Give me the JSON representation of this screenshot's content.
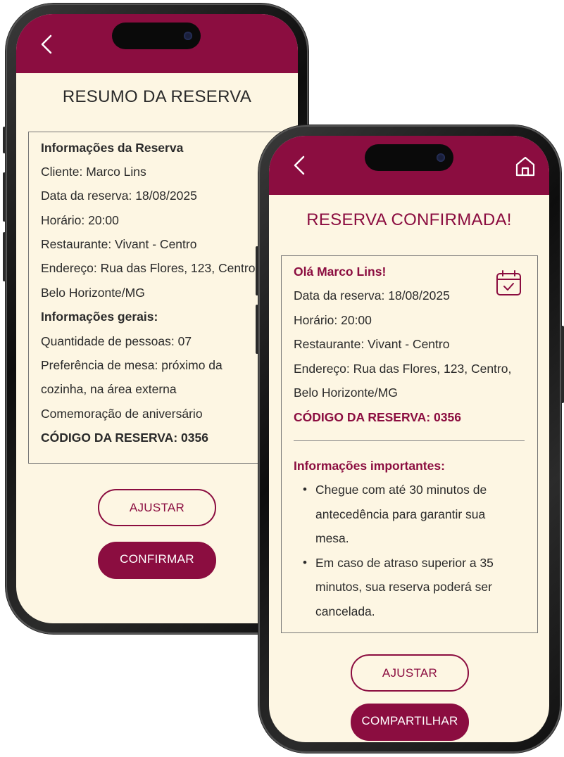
{
  "colors": {
    "accent": "#8b0d40",
    "background": "#fdf6e3",
    "text": "#2a2a2a"
  },
  "summary_screen": {
    "back_icon": "chevron-left-icon",
    "title": "RESUMO DA RESERVA",
    "section1_heading": "Informações da Reserva",
    "client": "Cliente: Marco Lins",
    "date": "Data da reserva: 18/08/2025",
    "time": "Horário: 20:00",
    "restaurant": "Restaurante: Vivant - Centro",
    "address_line1": "Endereço: Rua das Flores, 123, Centro,",
    "address_line2": "Belo Horizonte/MG",
    "section2_heading": "Informações gerais:",
    "people": "Quantidade de pessoas: 07",
    "table_pref_line1": "Preferência de mesa: próximo da",
    "table_pref_line2": "cozinha, na área externa",
    "celebration": "Comemoração de aniversário",
    "code": "CÓDIGO DA RESERVA: 0356",
    "adjust_button": "AJUSTAR",
    "confirm_button": "CONFIRMAR"
  },
  "confirmation_screen": {
    "back_icon": "chevron-left-icon",
    "home_icon": "home-icon",
    "title": "RESERVA CONFIRMADA!",
    "greeting": "Olá Marco Lins!",
    "calendar_icon": "calendar-check-icon",
    "date": "Data da reserva: 18/08/2025",
    "time": "Horário: 20:00",
    "restaurant": "Restaurante: Vivant - Centro",
    "address_line1": "Endereço: Rua das Flores, 123, Centro,",
    "address_line2": "Belo Horizonte/MG",
    "code": "CÓDIGO DA RESERVA: 0356",
    "important_heading": "Informações importantes:",
    "notes": [
      {
        "lines": [
          "Chegue com até 30 minutos de",
          "antecedência para garantir sua",
          "mesa."
        ]
      },
      {
        "lines": [
          "Em caso de atraso superior a 35",
          "minutos, sua reserva poderá ser",
          "cancelada."
        ]
      }
    ],
    "adjust_button": "AJUSTAR",
    "share_button": "COMPARTILHAR"
  }
}
